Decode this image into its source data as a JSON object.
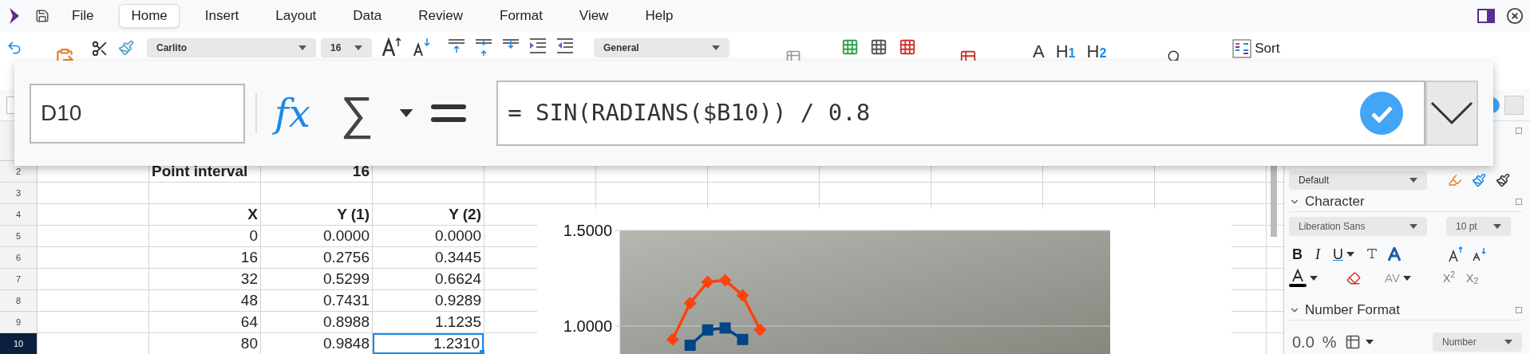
{
  "menu_bar": {
    "items": [
      {
        "label": "File",
        "selected": false
      },
      {
        "label": "Home",
        "selected": true
      },
      {
        "label": "Insert",
        "selected": false
      },
      {
        "label": "Layout",
        "selected": false
      },
      {
        "label": "Data",
        "selected": false
      },
      {
        "label": "Review",
        "selected": false
      },
      {
        "label": "Format",
        "selected": false
      },
      {
        "label": "View",
        "selected": false
      },
      {
        "label": "Help",
        "selected": false
      }
    ]
  },
  "toolbar": {
    "font_name": "Carlito",
    "font_size": "16",
    "number_format": "General",
    "style_buttons": [
      {
        "label": "A"
      },
      {
        "label": "H",
        "sub": "1"
      },
      {
        "label": "H",
        "sub": "2"
      }
    ],
    "sort_label": "Sort"
  },
  "formula_popup": {
    "name_box": "D10",
    "function_wizard": "fx",
    "sum": "∑",
    "formula": "= SIN(RADIANS($B10)) / 0.8"
  },
  "sheet": {
    "rows": [
      {
        "header": "2",
        "selected": false,
        "kind": "title",
        "cells": [
          {
            "text": "Point interval",
            "selected": false
          },
          {
            "text": "16",
            "selected": false
          }
        ]
      },
      {
        "header": "3",
        "selected": false,
        "kind": "data"
      },
      {
        "header": "4",
        "selected": false,
        "kind": "header",
        "cells": [
          {
            "text": "X",
            "selected": false
          },
          {
            "text": "Y (1)",
            "selected": false
          },
          {
            "text": "Y (2)",
            "selected": false
          }
        ]
      },
      {
        "header": "5",
        "selected": false,
        "kind": "data",
        "cells": [
          {
            "text": "0",
            "selected": false
          },
          {
            "text": "0.0000",
            "selected": false
          },
          {
            "text": "0.0000",
            "selected": false
          }
        ]
      },
      {
        "header": "6",
        "selected": false,
        "kind": "data",
        "cells": [
          {
            "text": "16",
            "selected": false
          },
          {
            "text": "0.2756",
            "selected": false
          },
          {
            "text": "0.3445",
            "selected": false
          }
        ]
      },
      {
        "header": "7",
        "selected": false,
        "kind": "data",
        "cells": [
          {
            "text": "32",
            "selected": false
          },
          {
            "text": "0.5299",
            "selected": false
          },
          {
            "text": "0.6624",
            "selected": false
          }
        ]
      },
      {
        "header": "8",
        "selected": false,
        "kind": "data",
        "cells": [
          {
            "text": "48",
            "selected": false
          },
          {
            "text": "0.7431",
            "selected": false
          },
          {
            "text": "0.9289",
            "selected": false
          }
        ]
      },
      {
        "header": "9",
        "selected": false,
        "kind": "data",
        "cells": [
          {
            "text": "64",
            "selected": false
          },
          {
            "text": "0.8988",
            "selected": false
          },
          {
            "text": "1.1235",
            "selected": false
          }
        ]
      },
      {
        "header": "10",
        "selected": true,
        "kind": "data",
        "cells": [
          {
            "text": "80",
            "selected": false
          },
          {
            "text": "0.9848",
            "selected": false
          },
          {
            "text": "1.2310",
            "selected": true
          }
        ]
      }
    ]
  },
  "chart": {
    "chart_data": {
      "type": "line",
      "categories": [
        null,
        null,
        null,
        null,
        null,
        null,
        null,
        null,
        null,
        null,
        null,
        null,
        null,
        null,
        null,
        null,
        null,
        null,
        null,
        null,
        null,
        null,
        null,
        null,
        null,
        null,
        null,
        null,
        null
      ],
      "ylim": [
        0.85,
        1.5
      ],
      "yticks": [
        {
          "value": 1.5,
          "label": "1.5000"
        },
        {
          "value": 1.0,
          "label": "1.0000"
        }
      ],
      "series": [
        {
          "color": "#004586",
          "marker": "square",
          "values": [
            null,
            null,
            null,
            null,
            0.9,
            0.98,
            0.99,
            0.93,
            null,
            null,
            null,
            null,
            null,
            null,
            null,
            null,
            null,
            null,
            null,
            null,
            null,
            null,
            null,
            null,
            null,
            null,
            null,
            null,
            null
          ]
        },
        {
          "color": "#ff420e",
          "marker": "diamond",
          "values": [
            null,
            null,
            null,
            0.93,
            1.12,
            1.23,
            1.24,
            1.16,
            0.98,
            null,
            null,
            null,
            null,
            null,
            null,
            null,
            null,
            null,
            null,
            null,
            null,
            null,
            null,
            null,
            null,
            null,
            null,
            null,
            null
          ]
        }
      ]
    }
  },
  "sidebar": {
    "paragraph_style": "Default",
    "sections": [
      {
        "title": "Character",
        "expanded": true
      },
      {
        "title": "Number Format",
        "expanded": true
      }
    ],
    "font_name": "Liberation Sans",
    "font_size": "10 pt",
    "format_letters": [
      "B",
      "I",
      "U"
    ],
    "spacing_label": "AV",
    "superscript": "X$^{2}$",
    "subscript": "X$_{2}$",
    "decimal_label": "0.0",
    "percent_label": "%",
    "number_format": "Number"
  }
}
